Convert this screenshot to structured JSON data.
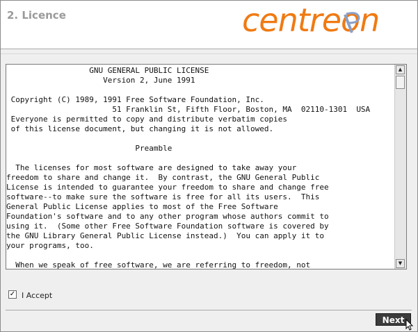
{
  "header": {
    "step_title": "2. Licence",
    "logo_text": "CENTREON"
  },
  "licence": {
    "text": "                  GNU GENERAL PUBLIC LICENSE\n                     Version 2, June 1991\n\n Copyright (C) 1989, 1991 Free Software Foundation, Inc.\n                       51 Franklin St, Fifth Floor, Boston, MA  02110-1301  USA\n Everyone is permitted to copy and distribute verbatim copies\n of this license document, but changing it is not allowed.\n\n                            Preamble\n\n  The licenses for most software are designed to take away your\nfreedom to share and change it.  By contrast, the GNU General Public\nLicense is intended to guarantee your freedom to share and change free\nsoftware--to make sure the software is free for all its users.  This\nGeneral Public License applies to most of the Free Software\nFoundation's software and to any other program whose authors commit to\nusing it.  (Some other Free Software Foundation software is covered by\nthe GNU Library General Public License instead.)  You can apply it to\nyour programs, too.\n\n  When we speak of free software, we are referring to freedom, not"
  },
  "accept": {
    "label": "I Accept",
    "checked": true,
    "check_glyph": "✓"
  },
  "footer": {
    "next_label": "Next"
  },
  "icons": {
    "scroll_up": "▲",
    "scroll_down": "▼"
  },
  "colors": {
    "logo_orange": "#f07a13",
    "logo_blue": "#8aa0c8",
    "step_title": "#9a9a9a",
    "next_button_bg": "#3c3c3c"
  }
}
